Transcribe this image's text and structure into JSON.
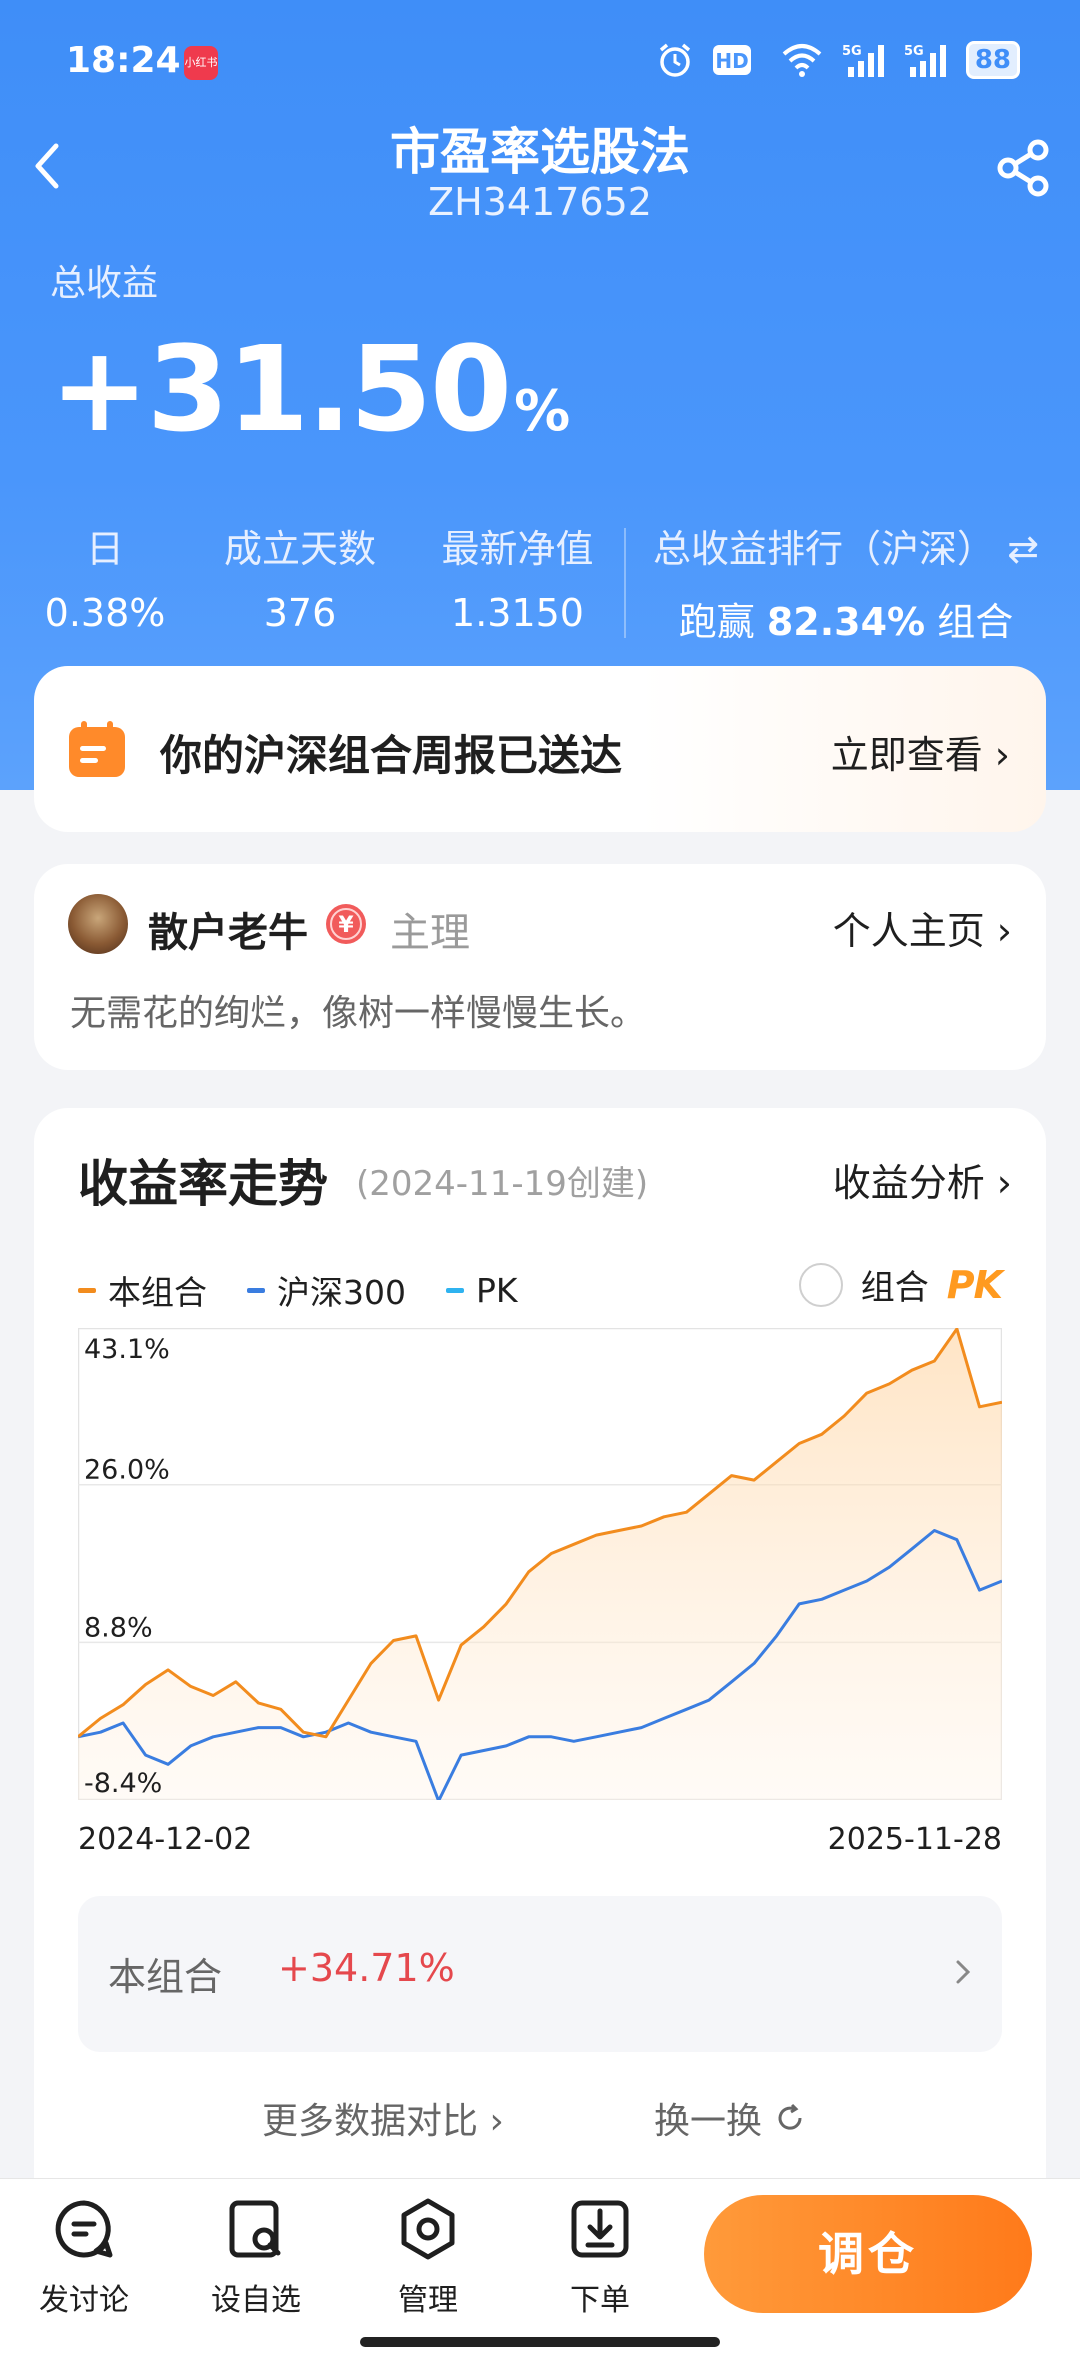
{
  "status_bar": {
    "time": "18:24",
    "app_badge": "小红书",
    "battery": "88",
    "network": "5G"
  },
  "header": {
    "title": "市盈率选股法",
    "code": "ZH3417652"
  },
  "summary": {
    "total_label": "总收益",
    "total_value": "+31.50",
    "total_unit": "%",
    "stats": [
      {
        "label": "日",
        "value": "0.38%"
      },
      {
        "label": "成立天数",
        "value": "376"
      },
      {
        "label": "最新净值",
        "value": "1.3150"
      }
    ],
    "rank_label": "总收益排行（沪深）",
    "rank_prefix": "跑赢",
    "rank_value": "82.34%",
    "rank_suffix": "组合"
  },
  "notice": {
    "text": "你的沪深组合周报已送达",
    "action": "立即查看"
  },
  "author": {
    "name": "散户老牛",
    "role": "主理",
    "link": "个人主页",
    "motto": "无需花的绚烂，像树一样慢慢生长。"
  },
  "chart_section": {
    "title": "收益率走势",
    "created": "(2024-11-19创建)",
    "link": "收益分析",
    "legend": [
      {
        "name": "本组合",
        "color": "#f28c1e"
      },
      {
        "name": "沪深300",
        "color": "#3a7de0"
      },
      {
        "name": "PK",
        "color": "#2fb3f0"
      }
    ],
    "pk_label": "组合",
    "pk_logo": "PK",
    "y_ticks": [
      "43.1%",
      "26.0%",
      "8.8%",
      "-8.4%"
    ],
    "date_start": "2024-12-02",
    "date_end": "2025-11-28",
    "compare_label": "本组合",
    "compare_value": "+34.71%",
    "more_data": "更多数据对比",
    "swap": "换一换"
  },
  "chart_data": {
    "type": "line",
    "title": "收益率走势",
    "x_range": [
      "2024-12-02",
      "2025-11-28"
    ],
    "ylim": [
      -8.4,
      43.1
    ],
    "y_ticks": [
      43.1,
      26.0,
      8.8,
      -8.4
    ],
    "series": [
      {
        "name": "本组合",
        "color": "#f28c1e",
        "values": [
          -1.5,
          0.5,
          2.0,
          4.2,
          5.8,
          4.0,
          3.0,
          4.5,
          2.2,
          1.5,
          -1.0,
          -1.5,
          2.5,
          6.5,
          9.0,
          9.5,
          2.5,
          8.5,
          10.5,
          13.0,
          16.5,
          18.5,
          19.5,
          20.5,
          21.0,
          21.5,
          22.5,
          23.0,
          25.0,
          27.0,
          26.5,
          28.5,
          30.5,
          31.5,
          33.5,
          36.0,
          37.0,
          38.5,
          39.5,
          43.0,
          34.5,
          35.0
        ]
      },
      {
        "name": "沪深300",
        "color": "#3a7de0",
        "values": [
          -1.5,
          -1.0,
          0.0,
          -3.5,
          -4.5,
          -2.5,
          -1.5,
          -1.0,
          -0.5,
          -0.5,
          -1.5,
          -1.0,
          0.0,
          -1.0,
          -1.5,
          -2.0,
          -8.5,
          -3.5,
          -3.0,
          -2.5,
          -1.5,
          -1.5,
          -2.0,
          -1.5,
          -1.0,
          -0.5,
          0.5,
          1.5,
          2.5,
          4.5,
          6.5,
          9.5,
          13.0,
          13.5,
          14.5,
          15.5,
          17.0,
          19.0,
          21.0,
          20.0,
          14.5,
          15.5
        ]
      }
    ],
    "grid": true,
    "legend_position": "top-left"
  },
  "tabbar": {
    "items": [
      {
        "label": "发讨论",
        "icon": "chat-icon"
      },
      {
        "label": "设自选",
        "icon": "watchlist-icon"
      },
      {
        "label": "管理",
        "icon": "settings-hex-icon"
      },
      {
        "label": "下单",
        "icon": "order-icon"
      }
    ],
    "cta": "调仓"
  }
}
